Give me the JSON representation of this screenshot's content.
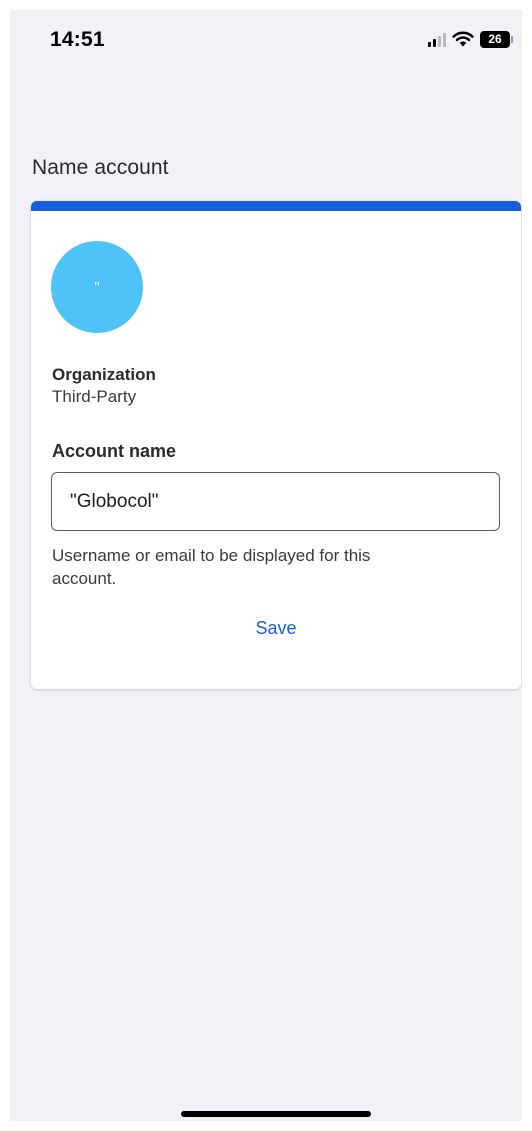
{
  "status_bar": {
    "time": "14:51",
    "battery": "26",
    "icons": [
      "signal-icon",
      "wifi-icon",
      "battery-icon"
    ]
  },
  "page": {
    "title": "Name account"
  },
  "card": {
    "accent_color": "#175ddc",
    "avatar": {
      "text": "\"",
      "color": "#4fc2f7"
    },
    "organization_label": "Organization",
    "organization_value": "Third-Party",
    "account_name_label": "Account name",
    "account_name_value": "\"Globocol\"",
    "helper_text": "Username or email to be displayed for this account.",
    "save_label": "Save"
  }
}
